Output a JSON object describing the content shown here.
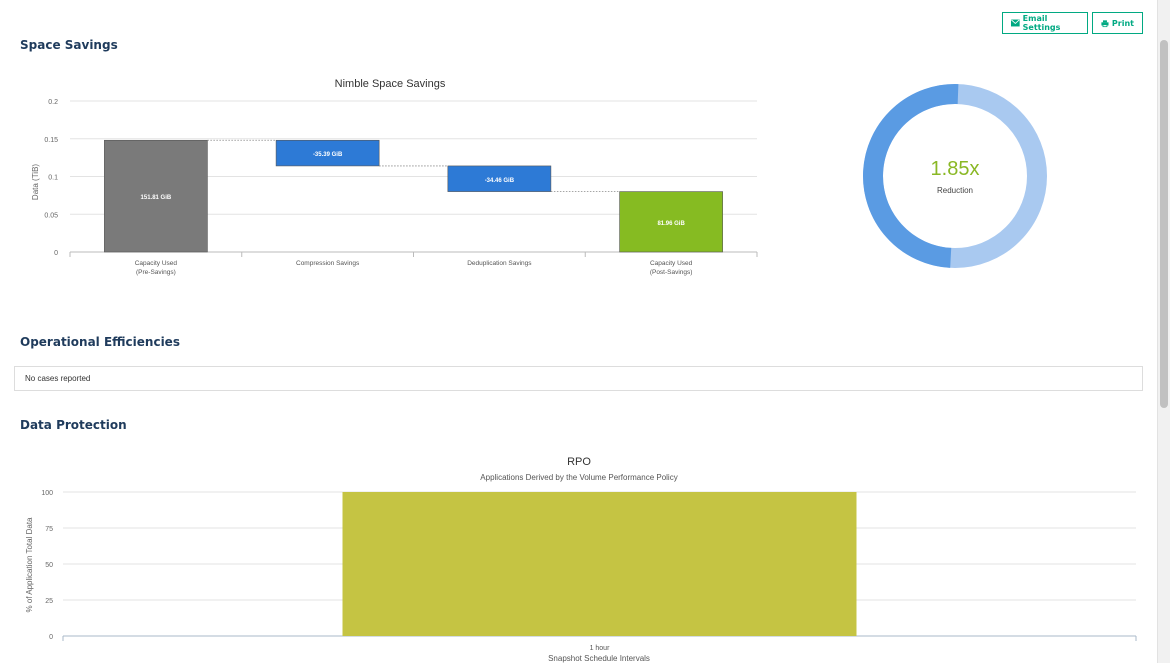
{
  "toolbar": {
    "email_label": "Email Settings",
    "print_label": "Print",
    "email_icon": "envelope-icon",
    "print_icon": "printer-icon",
    "accent": "#01a982"
  },
  "sections": {
    "space_savings": "Space Savings",
    "operational": "Operational Efficiencies",
    "data_protection": "Data Protection"
  },
  "operational": {
    "message": "No cases reported"
  },
  "donut": {
    "value": "1.85x",
    "label": "Reduction",
    "ratio": 1.85,
    "colors": [
      "#a9c9f0",
      "#5a9be3"
    ],
    "value_color": "#8ab825"
  },
  "chart_data": [
    {
      "type": "bar",
      "subtype": "waterfall",
      "title": "Nimble Space Savings",
      "ylabel": "Data (TiB)",
      "xlabel": "",
      "ylim": [
        0,
        0.2
      ],
      "yticks": [
        "0",
        "0.05",
        "0.1",
        "0.15",
        "0.2"
      ],
      "grid": true,
      "categories": [
        [
          "Capacity Used",
          "(Pre-Savings)"
        ],
        [
          "Compression Savings"
        ],
        [
          "Deduplication Savings"
        ],
        [
          "Capacity Used",
          "(Post-Savings)"
        ]
      ],
      "bars": [
        {
          "start": 0,
          "end": 0.148,
          "label": "151.81 GiB",
          "color": "#7a7a7a"
        },
        {
          "start": 0.114,
          "end": 0.148,
          "label": "-35.39 GiB",
          "color": "#2d7ad6"
        },
        {
          "start": 0.08,
          "end": 0.114,
          "label": "-34.46 GiB",
          "color": "#2d7ad6"
        },
        {
          "start": 0,
          "end": 0.08,
          "label": "81.96 GiB",
          "color": "#86bb22"
        }
      ]
    },
    {
      "type": "bar",
      "title": "RPO",
      "subtitle": "Applications Derived by the Volume Performance Policy",
      "xlabel": "Snapshot Schedule Intervals",
      "ylabel": "% of Application Total Data",
      "ylim": [
        0,
        100
      ],
      "yticks": [
        "0",
        "25",
        "50",
        "75",
        "100"
      ],
      "grid": true,
      "categories": [
        "1 hour"
      ],
      "values": [
        100
      ],
      "color": "#c5c443"
    }
  ]
}
